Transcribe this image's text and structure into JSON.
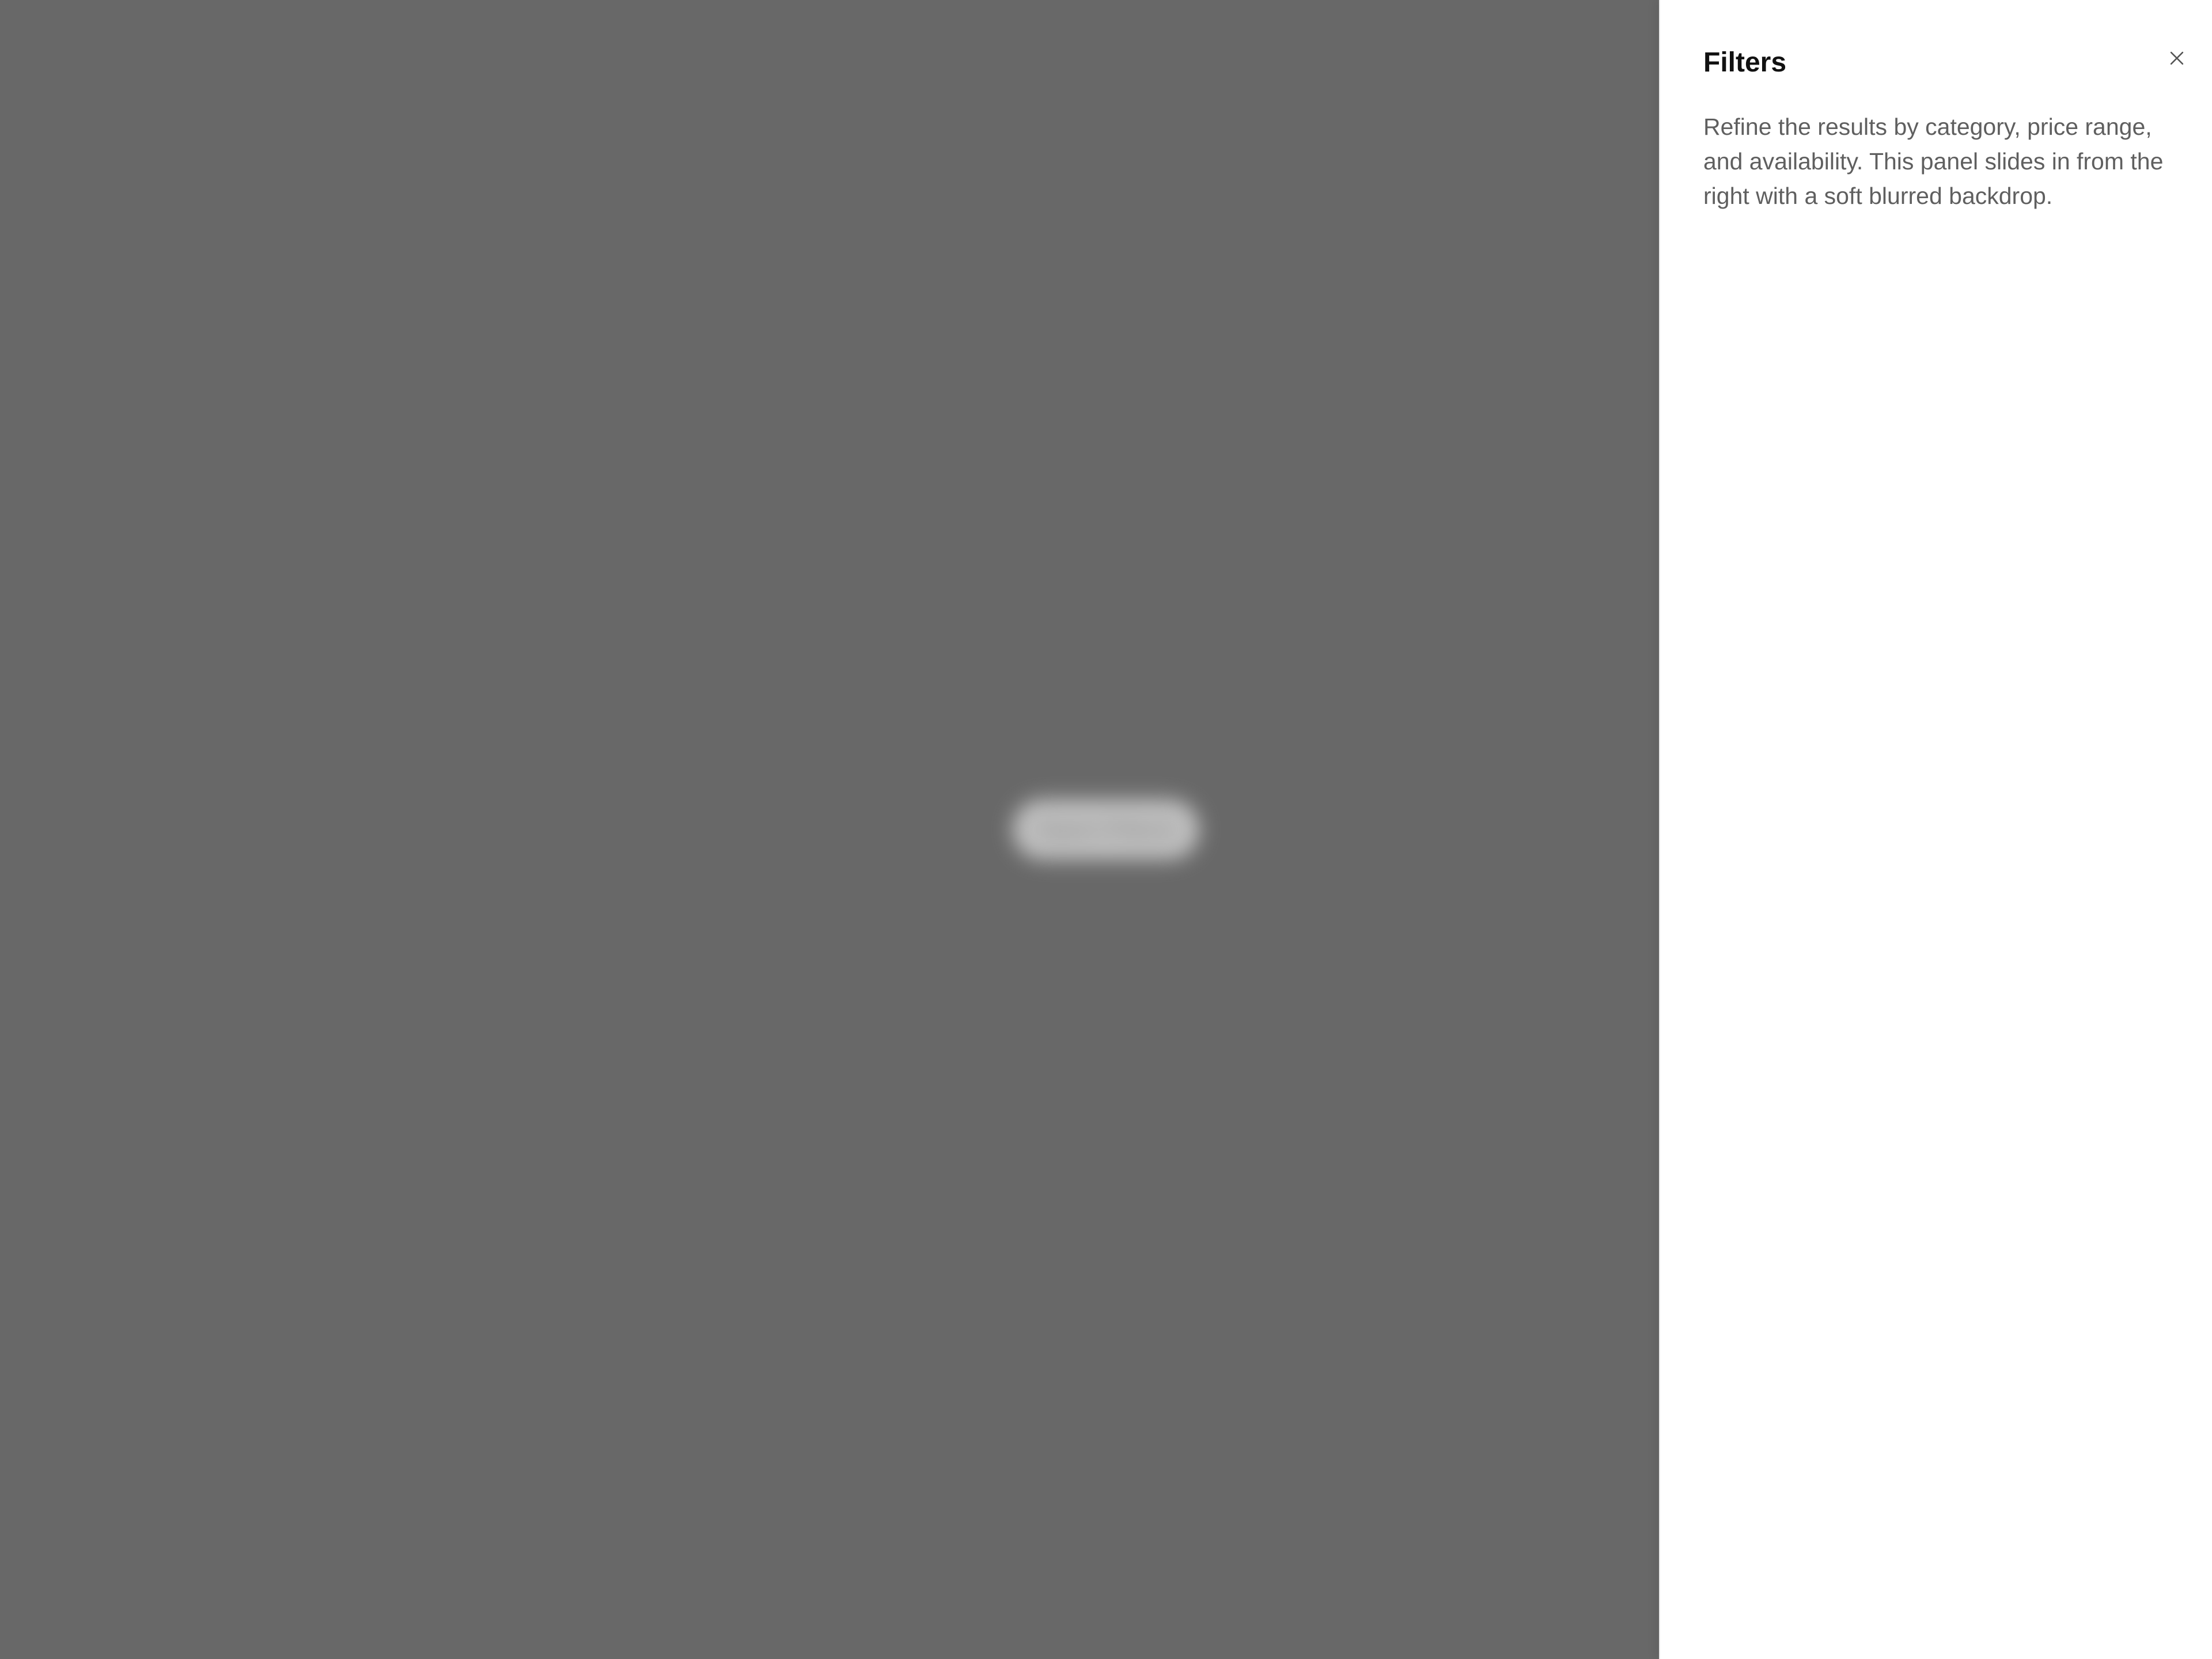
{
  "backdrop": {
    "button_label": "Open Filters"
  },
  "panel": {
    "title": "Filters",
    "description": "Refine the results by category, price range, and availability. This panel slides in from the right with a soft blurred backdrop.",
    "close_icon": "close-icon"
  },
  "colors": {
    "backdrop": "#686868",
    "panel": "#ffffff",
    "title": "#111111",
    "description": "#5f5f5f",
    "icon": "#555555"
  }
}
